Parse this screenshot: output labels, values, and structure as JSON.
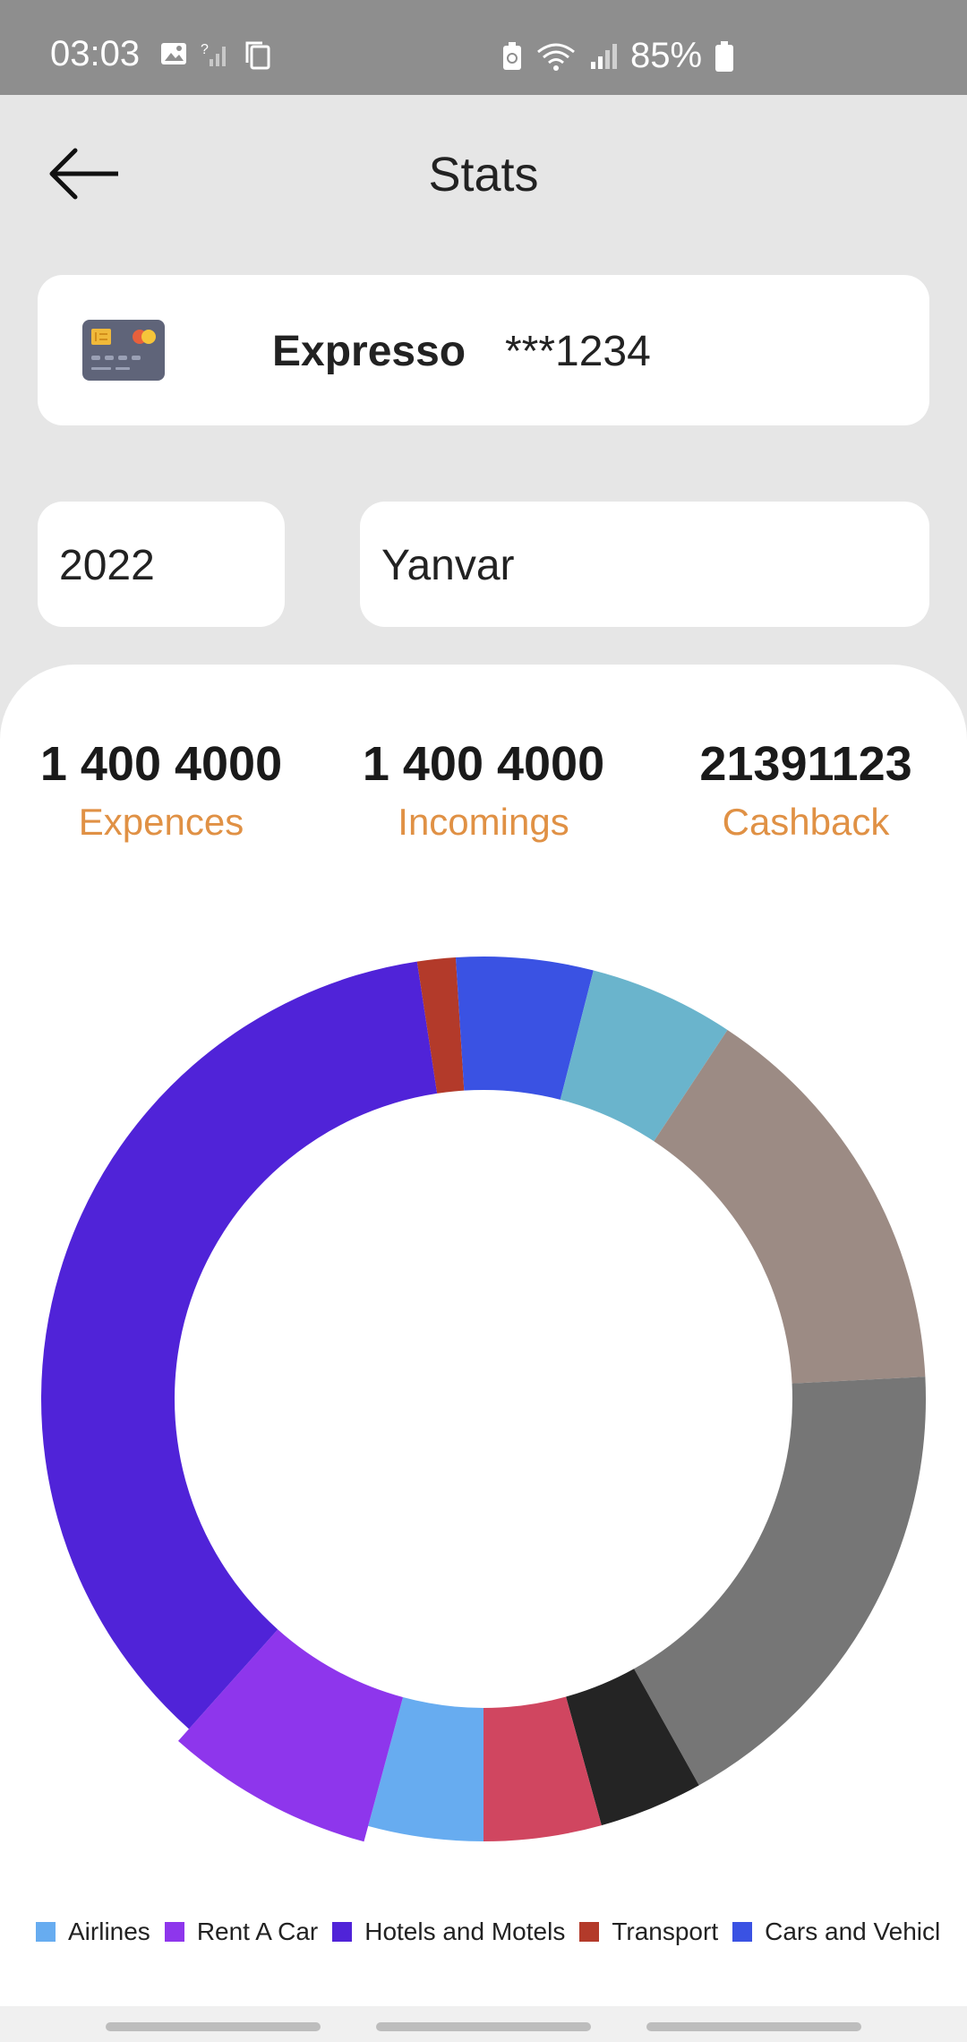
{
  "status_bar": {
    "time": "03:03",
    "battery": "85%",
    "icons_left": [
      "image-icon",
      "no-signal-icon",
      "copy-icon"
    ],
    "icons_right": [
      "battery-saver-icon",
      "wifi-icon",
      "signal-icon",
      "battery-icon"
    ]
  },
  "header": {
    "title": "Stats",
    "back_icon": "arrow-left-icon"
  },
  "card": {
    "icon": "credit-card-icon",
    "name": "Expresso",
    "number": "***1234"
  },
  "filters": {
    "year": "2022",
    "month": "Yanvar"
  },
  "summary": {
    "expenses_value": "1 400 4000",
    "expenses_label": "Expences",
    "incomings_value": "1 400 4000",
    "incomings_label": "Incomings",
    "cashback_value": "21391123",
    "cashback_label": "Cashback",
    "label_color": "#e09145"
  },
  "chart_data": {
    "type": "pie",
    "donut": true,
    "legend_position": "bottom",
    "slices": [
      {
        "name": "Airlines",
        "value": 4.2,
        "color": "#67acf0"
      },
      {
        "name": "Rent A Car",
        "value": 7.4,
        "color": "#8e36ec",
        "highlighted": true
      },
      {
        "name": "Hotels and Motels",
        "value": 36.0,
        "color": "#5023d8"
      },
      {
        "name": "Transport",
        "value": 1.4,
        "color": "#b33a2a"
      },
      {
        "name": "Cars and Vehicles",
        "value": 5.0,
        "color": "#3a52e3"
      },
      {
        "name": "",
        "value": 5.3,
        "color": "#6ab4cc"
      },
      {
        "name": "",
        "value": 14.9,
        "color": "#9c8b84"
      },
      {
        "name": "",
        "value": 17.7,
        "color": "#767676"
      },
      {
        "name": "",
        "value": 3.8,
        "color": "#242424"
      },
      {
        "name": "",
        "value": 4.3,
        "color": "#d04660"
      }
    ]
  }
}
